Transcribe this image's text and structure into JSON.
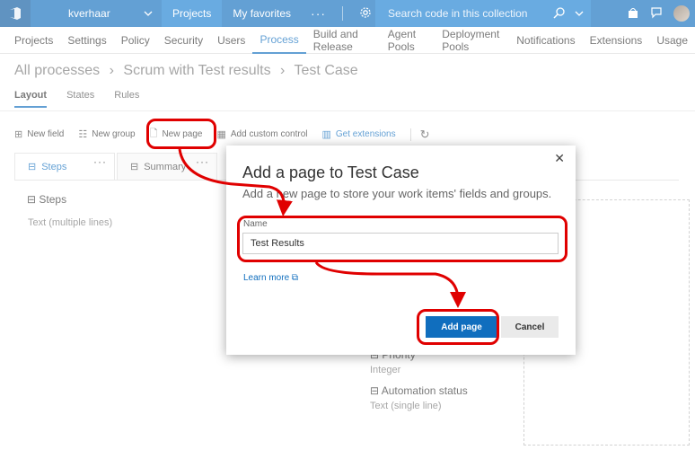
{
  "topbar": {
    "user": "kverhaar",
    "projects": "Projects",
    "favorites": "My favorites",
    "more": "···",
    "search_placeholder": "Search code in this collection"
  },
  "nav": {
    "items": [
      "Projects",
      "Settings",
      "Policy",
      "Security",
      "Users",
      "Process",
      "Build and Release",
      "Agent Pools",
      "Deployment Pools",
      "Notifications",
      "Extensions",
      "Usage"
    ],
    "active": "Process"
  },
  "breadcrumb": [
    "All processes",
    "Scrum with Test results",
    "Test Case"
  ],
  "subtabs": [
    "Layout",
    "States",
    "Rules"
  ],
  "toolbar": {
    "new_field": "New field",
    "new_group": "New group",
    "new_page": "New page",
    "add_custom_control": "Add custom control",
    "get_extensions": "Get extensions"
  },
  "page_tabs": [
    "Steps",
    "Summary"
  ],
  "steps_group": {
    "title": "Steps",
    "sub": "Text (multiple lines)"
  },
  "fields": [
    {
      "name": "Priority",
      "type": "Integer"
    },
    {
      "name": "Automation status",
      "type": "Text (single line)"
    }
  ],
  "dialog": {
    "title": "Add a page to Test Case",
    "description": "Add a new page to store your work items' fields and groups.",
    "name_label": "Name",
    "name_value": "Test Results",
    "learn_more": "Learn more",
    "add_button": "Add page",
    "cancel_button": "Cancel"
  },
  "colors": {
    "brand": "#106ebe",
    "callout": "#e00000"
  }
}
